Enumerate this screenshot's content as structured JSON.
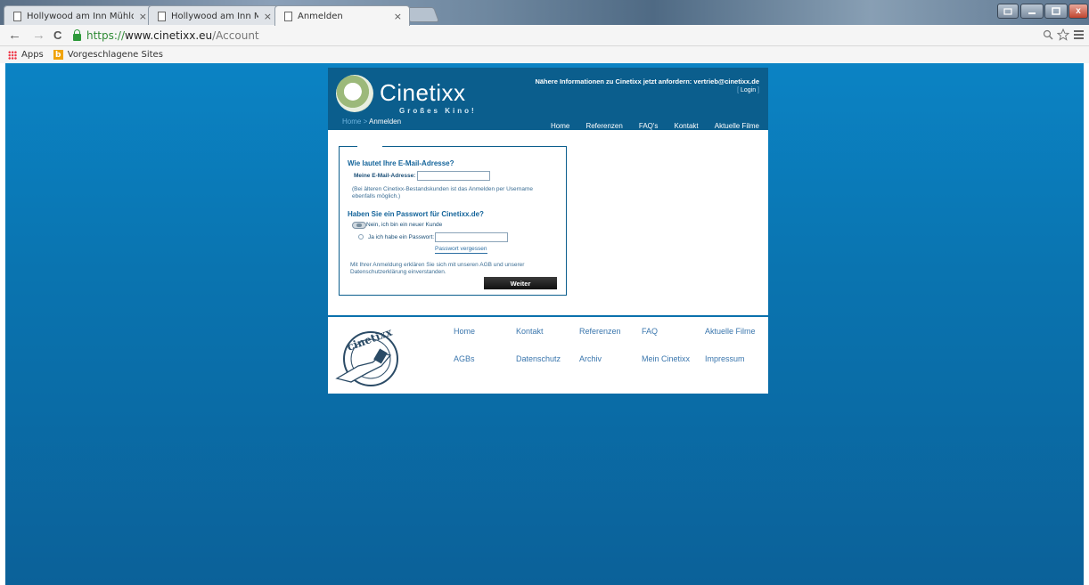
{
  "browser": {
    "tabs": [
      {
        "title": "Hollywood am Inn Mühldo",
        "close": "×"
      },
      {
        "title": "Hollywood am Inn Mühldo",
        "close": "×"
      },
      {
        "title": "Anmelden",
        "close": "×"
      }
    ],
    "url": {
      "scheme": "https://",
      "host": "www.cinetixx.eu",
      "path": "/Account"
    },
    "nav": {
      "back": "←",
      "forward": "→",
      "reload": "C"
    },
    "icons": {
      "zoom": "search-zoom-icon",
      "star": "star-icon",
      "menu": "menu-icon"
    },
    "bookmarks": {
      "apps": "Apps",
      "suggested": "Vorgeschlagene Sites"
    },
    "window": {
      "close": "x"
    }
  },
  "site": {
    "logo": {
      "name": "Cinetixx",
      "slogan": "Großes Kino!",
      "badge": "CINETIXX"
    },
    "breadcrumb": {
      "home": "Home",
      "sep": " > ",
      "current": "Anmelden"
    },
    "info": "Nähere Informationen zu Cinetixx jetzt anfordern: vertrieb@cinetixx.de",
    "login": {
      "left": "[ ",
      "label": "Login",
      "right": " ]"
    },
    "nav": [
      "Home",
      "Referenzen",
      "FAQ's",
      "Kontakt",
      "Aktuelle Filme"
    ],
    "form": {
      "q_email": "Wie lautet Ihre E-Mail-Adresse?",
      "email_label": "Meine E-Mail-Adresse:",
      "email_value": "",
      "email_note": "(Bei älteren Cinetixx-Bestandskunden ist das Anmelden per Username ebenfalls möglich.)",
      "q_password": "Haben Sie ein Passwort für Cinetixx.de?",
      "option_new": "Nein, ich bin ein neuer Kunde",
      "option_existing": "Ja ich habe ein Passwort:",
      "password_value": "",
      "forgot": "Passwort vergessen",
      "terms": "Mit Ihrer Anmeldung erklären Sie sich mit unseren AGB und unserer Datenschutzerklärung einverstanden.",
      "submit": "Weiter"
    },
    "footer": {
      "row1": [
        "Home",
        "Kontakt",
        "Referenzen",
        "FAQ",
        "Aktuelle Filme"
      ],
      "row2": [
        "AGBs",
        "Datenschutz",
        "Archiv",
        "Mein Cinetixx",
        "Impressum"
      ],
      "logo_text": "cinetixx"
    }
  }
}
